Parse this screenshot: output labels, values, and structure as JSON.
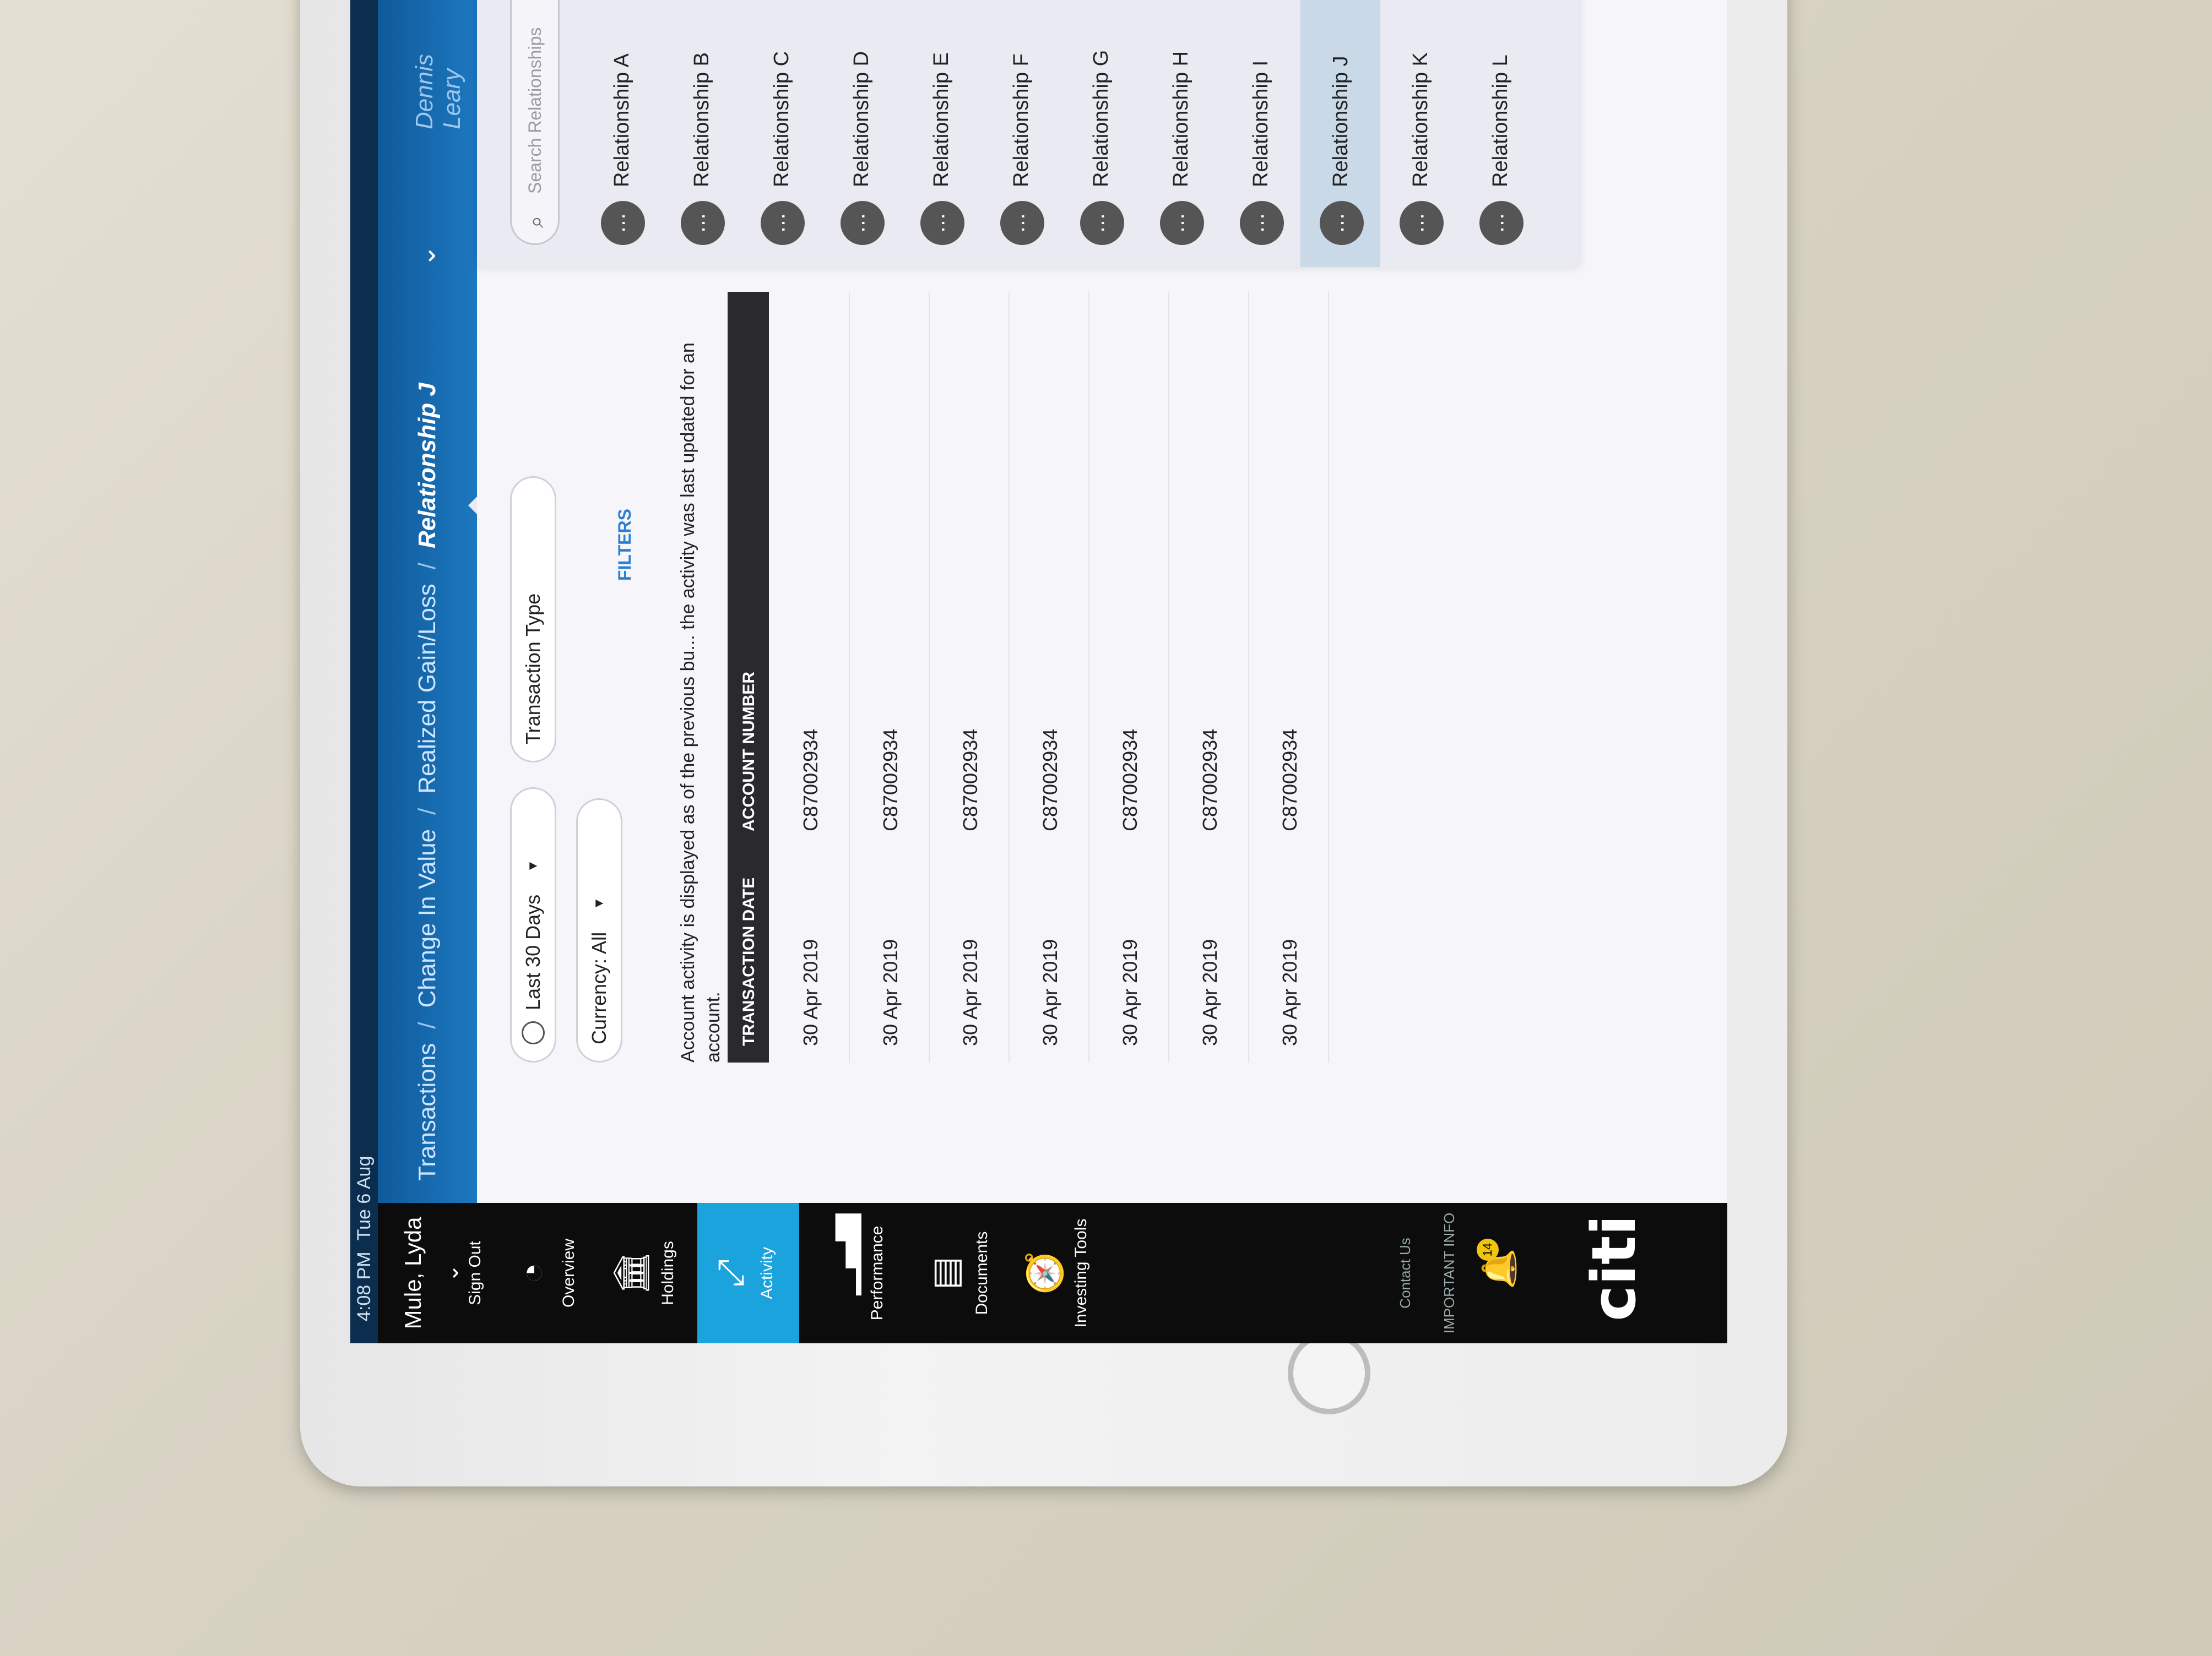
{
  "status": {
    "time": "4:08 PM",
    "date": "Tue 6 Aug"
  },
  "sidebar": {
    "user_name": "Mule, Lyda",
    "sign_out": "Sign Out",
    "items": [
      {
        "label": "Overview",
        "icon": "gauge-icon"
      },
      {
        "label": "Holdings",
        "icon": "bank-icon"
      },
      {
        "label": "Activity",
        "icon": "arrows-icon"
      },
      {
        "label": "Performance",
        "icon": "bar-chart-icon"
      },
      {
        "label": "Documents",
        "icon": "document-icon"
      },
      {
        "label": "Investing Tools",
        "icon": "compass-icon"
      }
    ],
    "contact": "Contact Us",
    "important": "IMPORTANT INFO",
    "bell_count": "14",
    "logo": "citi"
  },
  "topnav": {
    "crumbs": [
      "Transactions",
      "Change In Value",
      "Realized Gain/Loss"
    ],
    "current": "Relationship J",
    "user": "Dennis Leary"
  },
  "filters": {
    "date_range": "Last 30 Days",
    "transaction_type": "Transaction Type",
    "currency": "Currency: All",
    "filters_link": "FILTERS"
  },
  "notice": "Account activity is displayed as of the previous bu... the activity was last updated for an account.",
  "table": {
    "headers": [
      "TRANSACTION DATE",
      "ACCOUNT NUMBER"
    ],
    "rows": [
      [
        "30 Apr 2019",
        "C87002934"
      ],
      [
        "30 Apr 2019",
        "C87002934"
      ],
      [
        "30 Apr 2019",
        "C87002934"
      ],
      [
        "30 Apr 2019",
        "C87002934"
      ],
      [
        "30 Apr 2019",
        "C87002934"
      ],
      [
        "30 Apr 2019",
        "C87002934"
      ],
      [
        "30 Apr 2019",
        "C87002934"
      ]
    ]
  },
  "dropdown": {
    "search_placeholder": "Search Relationships",
    "items": [
      "Relationship A",
      "Relationship B",
      "Relationship C",
      "Relationship D",
      "Relationship E",
      "Relationship F",
      "Relationship G",
      "Relationship H",
      "Relationship I",
      "Relationship J",
      "Relationship K",
      "Relationship L"
    ],
    "selected": "Relationship J"
  }
}
